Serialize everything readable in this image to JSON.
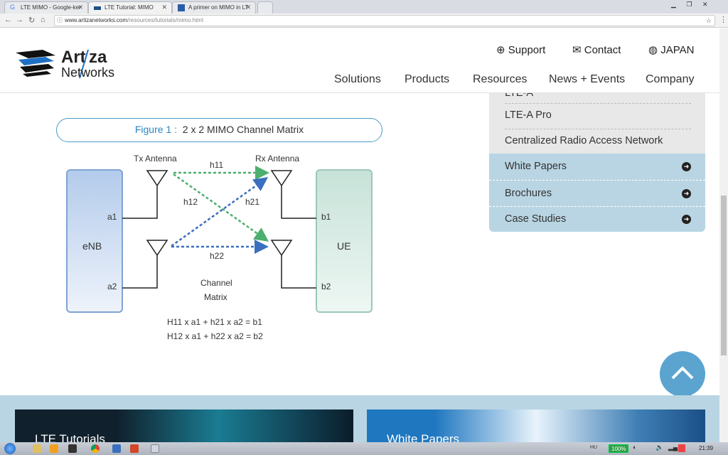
{
  "browser": {
    "tabs": [
      {
        "label": "LTE MIMO - Google-ker"
      },
      {
        "label": "LTE Tutorial: MIMO"
      },
      {
        "label": "A primer on MIMO in LT"
      }
    ],
    "url_host": "www.artizanetworks.com",
    "url_path": "/resources/tutorials/mimo.html"
  },
  "header": {
    "logo_text": "Artiza Networks",
    "top_links": [
      {
        "label": "Support",
        "icon": "lifebuoy-icon"
      },
      {
        "label": "Contact",
        "icon": "envelope-icon"
      },
      {
        "label": "JAPAN",
        "icon": "globe-icon"
      }
    ],
    "nav": [
      "Solutions",
      "Products",
      "Resources",
      "News + Events",
      "Company"
    ]
  },
  "sidebar": {
    "items": [
      {
        "label": "LTE-A"
      },
      {
        "label": "LTE-A Pro"
      },
      {
        "label": "Centralized Radio Access Network"
      }
    ],
    "sections": [
      {
        "label": "White Papers"
      },
      {
        "label": "Brochures"
      },
      {
        "label": "Case Studies"
      }
    ]
  },
  "figure": {
    "label": "Figure 1 :",
    "title": "2 x 2 MIMO Channel Matrix",
    "tx": "Tx Antenna",
    "rx": "Rx Antenna",
    "enb": "eNB",
    "ue": "UE",
    "a1": "a1",
    "a2": "a2",
    "b1": "b1",
    "b2": "b2",
    "h11": "h11",
    "h12": "h12",
    "h21": "h21",
    "h22": "h22",
    "channel": "Channel",
    "matrix": "Matrix",
    "eq1": "H11 x a1 + h21 x a2 = b1",
    "eq2": "H12 x a1 + h22 x a2 = b2",
    "colors": {
      "green": "#4caf6e",
      "blue": "#3a6fbf"
    }
  },
  "footer": {
    "cards": [
      "LTE Tutorials",
      "White Papers"
    ]
  },
  "taskbar": {
    "lang": "HU",
    "battery": "100%",
    "time": "21:39"
  }
}
